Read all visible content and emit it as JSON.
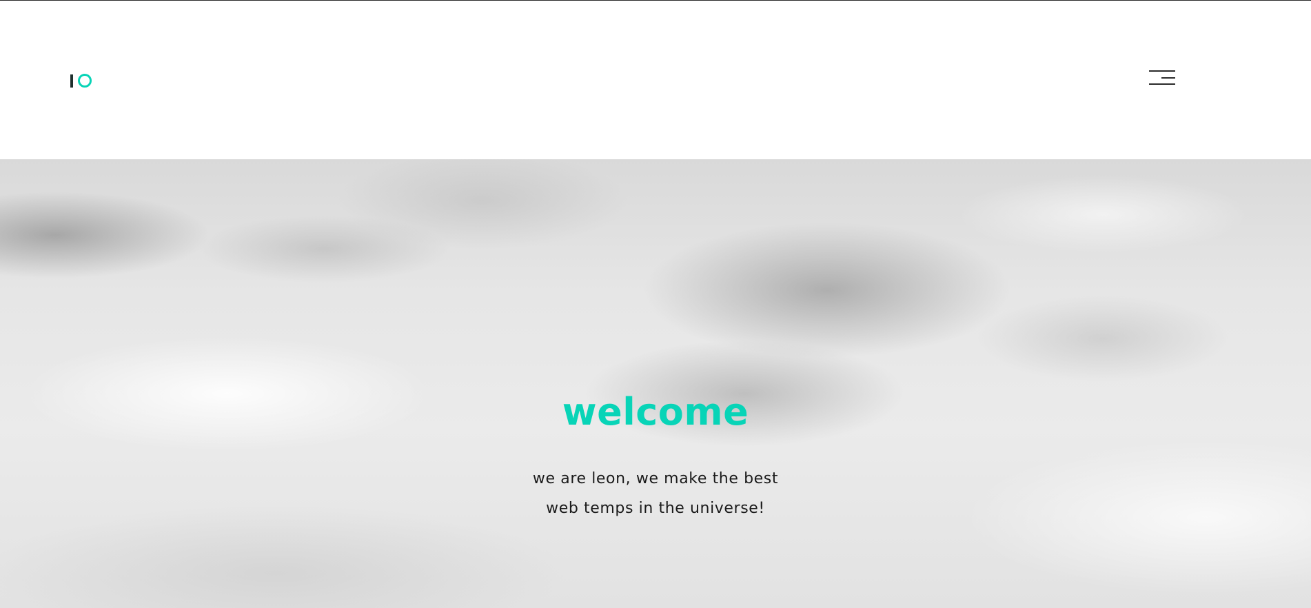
{
  "colors": {
    "accent": "#08d4b7",
    "logo_bar": "#1f2f2d",
    "text": "#1a1a1a",
    "menu_lines": "#2a2a2a"
  },
  "header": {
    "logo_icon": "logo-mark",
    "menu_icon": "hamburger-menu-icon"
  },
  "hero": {
    "background": "cloudy-sky-image",
    "title": "welcome",
    "subtitle_line_1": "we are leon, we make the best",
    "subtitle_line_2": "web temps in the universe!"
  }
}
